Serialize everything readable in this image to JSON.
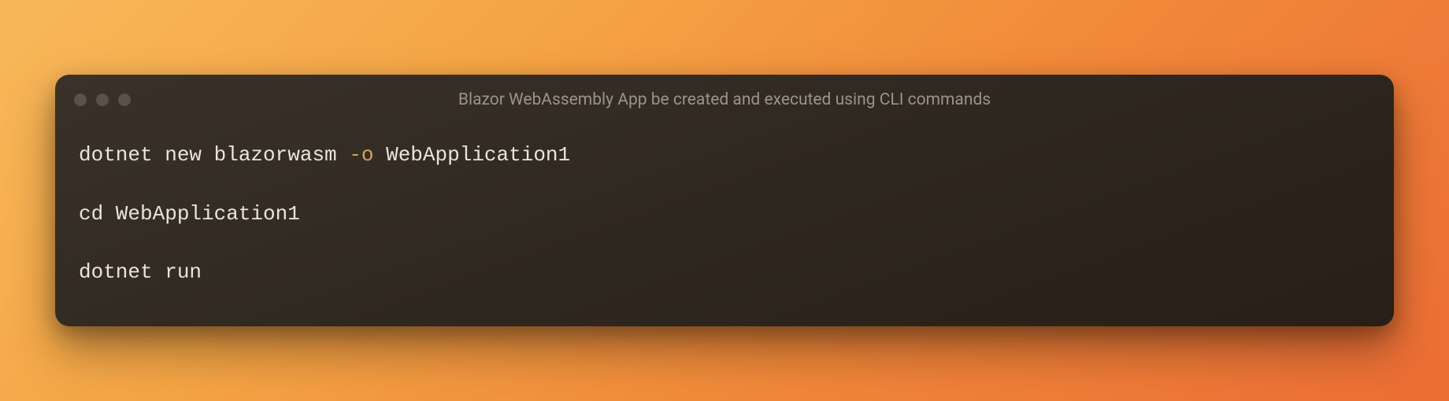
{
  "window": {
    "title": "Blazor WebAssembly App be created and executed using CLI commands"
  },
  "code": {
    "line1_cmd": "dotnet new blazorwasm ",
    "line1_flag": "-o",
    "line1_arg": " WebApplication1",
    "line2": "cd WebApplication1",
    "line3": "dotnet run"
  }
}
